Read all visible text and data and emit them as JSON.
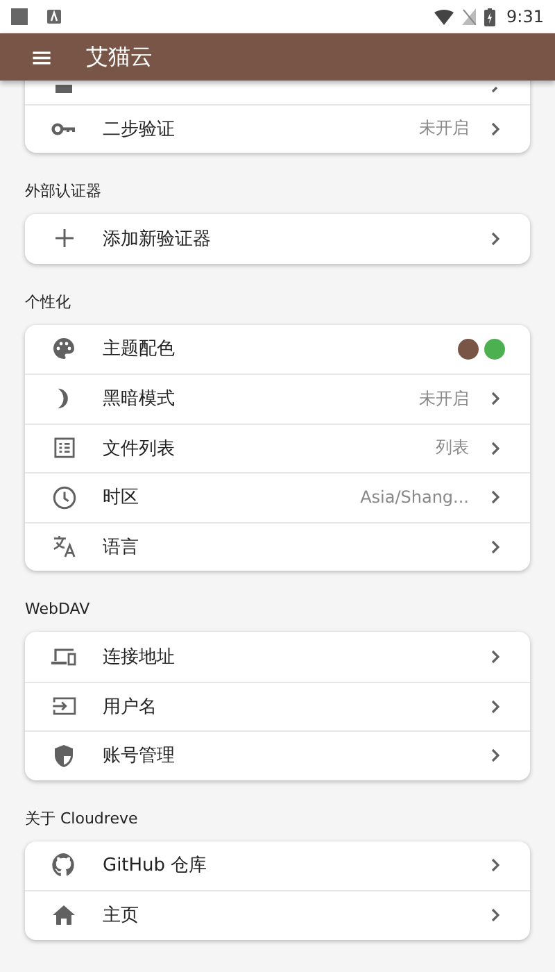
{
  "status_bar": {
    "time": "9:31"
  },
  "app_bar": {
    "menu_icon": "≡",
    "title": "艾猫云"
  },
  "sections": [
    {
      "items": [
        {
          "kind": "covered"
        },
        {
          "kind": "link",
          "label": "二步验证",
          "value": "未开启"
        }
      ]
    },
    {
      "title": "外部认证器",
      "items": [
        {
          "kind": "link",
          "label": "添加新验证器"
        }
      ]
    },
    {
      "title": "个性化",
      "items": [
        {
          "kind": "colors",
          "label": "主题配色",
          "colors": [
            {
              "color": "#795548"
            },
            {
              "color": "#4caf50"
            }
          ]
        },
        {
          "kind": "link",
          "label": "黑暗模式",
          "value": "未开启"
        },
        {
          "kind": "link",
          "label": "文件列表",
          "value": "列表"
        },
        {
          "kind": "link",
          "label": "时区",
          "value": "Asia/Shang..."
        },
        {
          "kind": "link",
          "label": "语言"
        }
      ]
    },
    {
      "title": "WebDAV",
      "items": [
        {
          "kind": "link",
          "label": "连接地址"
        },
        {
          "kind": "link",
          "label": "用户名"
        },
        {
          "kind": "link",
          "label": "账号管理"
        }
      ]
    },
    {
      "title": "关于 Cloudreve",
      "items": [
        {
          "kind": "link",
          "label": "GitHub 仓库"
        },
        {
          "kind": "link",
          "label": "主页"
        }
      ]
    }
  ]
}
